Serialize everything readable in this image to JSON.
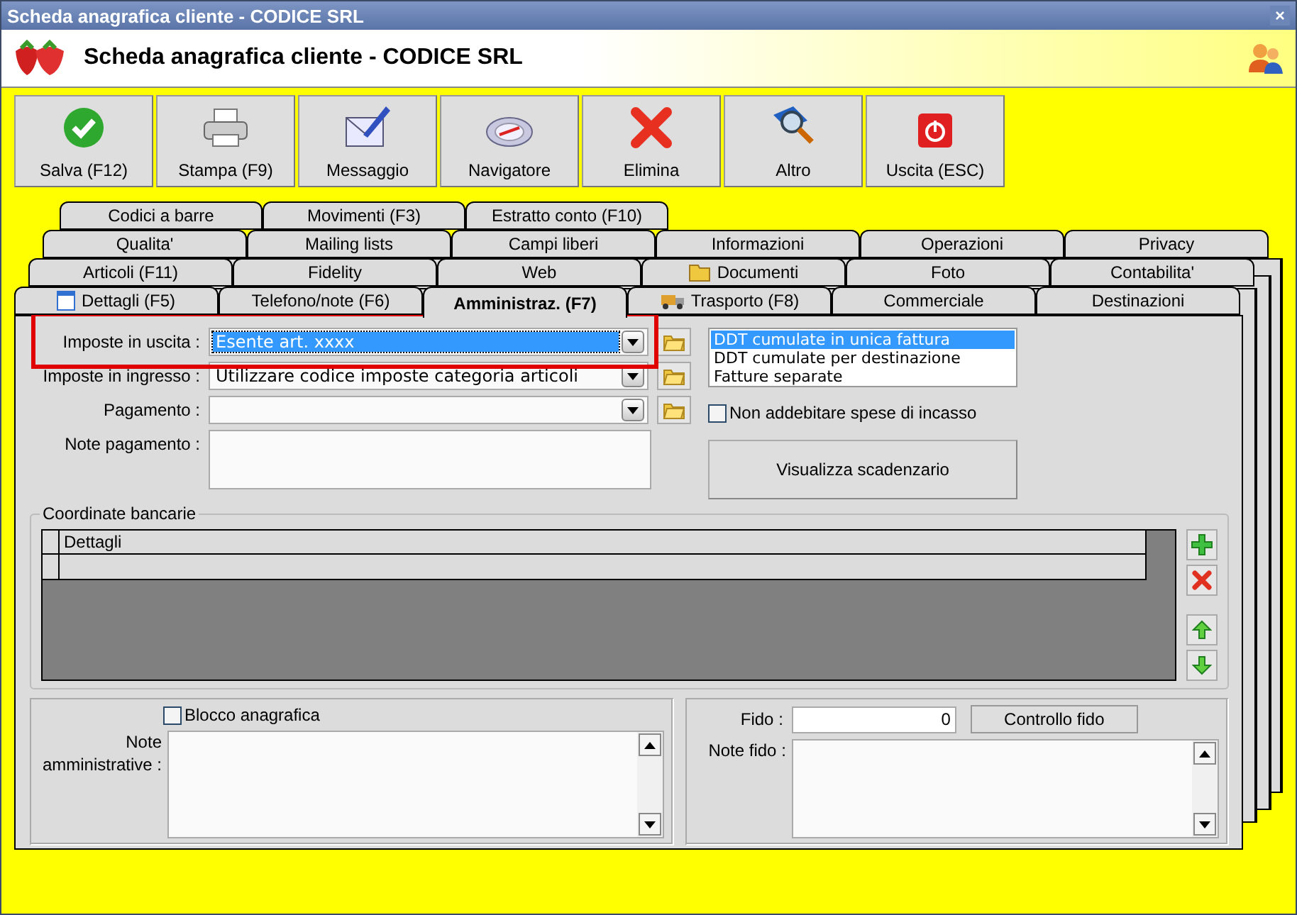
{
  "window": {
    "title": "Scheda anagrafica cliente - CODICE SRL",
    "close": "×"
  },
  "header": {
    "title": "Scheda anagrafica cliente - CODICE SRL"
  },
  "toolbar": [
    {
      "label": "Salva (F12)"
    },
    {
      "label": "Stampa (F9)"
    },
    {
      "label": "Messaggio"
    },
    {
      "label": "Navigatore"
    },
    {
      "label": "Elimina"
    },
    {
      "label": "Altro"
    },
    {
      "label": "Uscita (ESC)"
    }
  ],
  "tab_rows": [
    [
      {
        "label": "Codici a barre",
        "selected": false
      },
      {
        "label": "Movimenti (F3)",
        "selected": false
      },
      {
        "label": "Estratto conto (F10)",
        "selected": false
      }
    ],
    [
      {
        "label": "Qualita'",
        "selected": false
      },
      {
        "label": "Mailing lists",
        "selected": false
      },
      {
        "label": "Campi liberi",
        "selected": false
      },
      {
        "label": "Informazioni",
        "selected": false
      },
      {
        "label": "Operazioni",
        "selected": false
      },
      {
        "label": "Privacy",
        "selected": false
      }
    ],
    [
      {
        "label": "Articoli (F11)",
        "selected": false
      },
      {
        "label": "Fidelity",
        "selected": false
      },
      {
        "label": "Web",
        "selected": false
      },
      {
        "label": "Documenti",
        "selected": false
      },
      {
        "label": "Foto",
        "selected": false
      },
      {
        "label": "Contabilita'",
        "selected": false
      }
    ],
    [
      {
        "label": "Dettagli (F5)",
        "selected": false
      },
      {
        "label": "Telefono/note (F6)",
        "selected": false
      },
      {
        "label": "Amministraz. (F7)",
        "selected": true
      },
      {
        "label": "Trasporto (F8)",
        "selected": false
      },
      {
        "label": "Commerciale",
        "selected": false
      },
      {
        "label": "Destinazioni",
        "selected": false
      }
    ]
  ],
  "fields": [
    {
      "label": "Imposte in uscita :",
      "value": "Esente art. xxxx",
      "focused": true
    },
    {
      "label": "Imposte in ingresso :",
      "value": "Utilizzare codice imposte categoria articoli",
      "focused": false
    },
    {
      "label": "Pagamento :",
      "focused": false
    }
  ],
  "note_pagamento": {
    "label": "Note pagamento :"
  },
  "invoice_mode": [
    {
      "label": "DDT cumulate in unica fattura",
      "selected": true
    },
    {
      "label": "DDT cumulate per destinazione",
      "selected": false
    },
    {
      "label": "Fatture separate",
      "selected": false
    }
  ],
  "no_charge_checkbox": {
    "label": "Non addebitare spese di incasso",
    "checked": false
  },
  "schedule_button": "Visualizza scadenzario",
  "bank": {
    "title": "Coordinate bancarie",
    "columns": [
      "Dettagli"
    ]
  },
  "admin": {
    "block_checkbox": {
      "label": "Blocco anagrafica",
      "checked": false
    },
    "notes_label": "Note amministrative :"
  },
  "credit": {
    "label": "Fido :",
    "value": "0",
    "button": "Controllo fido",
    "notes_label": "Note fido :"
  }
}
